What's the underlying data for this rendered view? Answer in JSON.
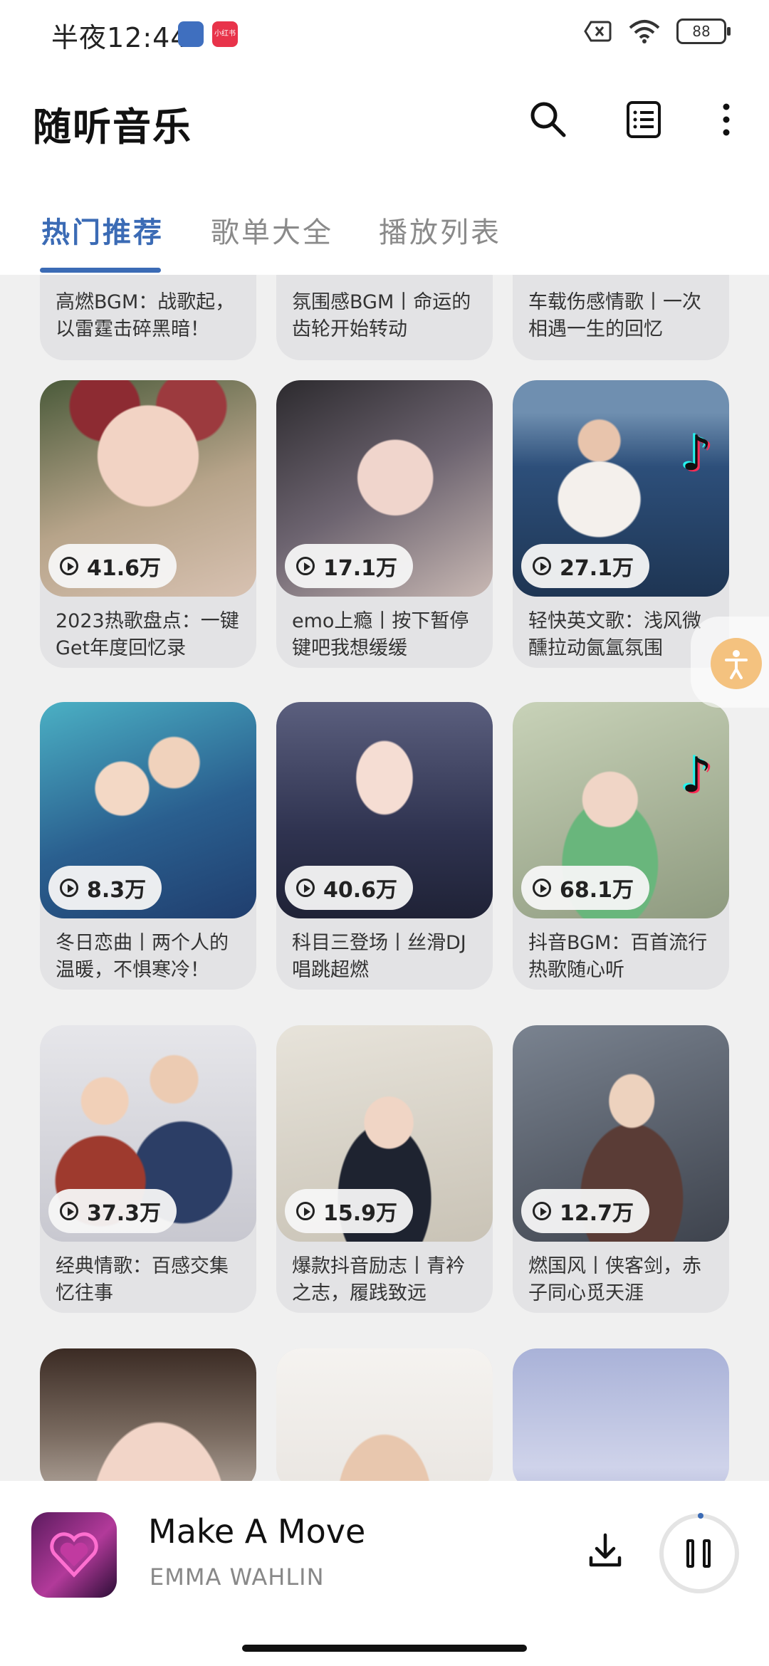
{
  "status_bar": {
    "time": "半夜12:44",
    "notification_app": "小红书",
    "battery": "88"
  },
  "app": {
    "title": "随听音乐"
  },
  "tabs": [
    {
      "label": "热门推荐",
      "active": true
    },
    {
      "label": "歌单大全",
      "active": false
    },
    {
      "label": "播放列表",
      "active": false
    }
  ],
  "top_partial_cards": [
    {
      "title": "高燃BGM：战歌起，以雷霆击碎黑暗！"
    },
    {
      "title": "氛围感BGM丨命运的齿轮开始转动"
    },
    {
      "title": "车载伤感情歌丨一次相遇一生的回忆"
    }
  ],
  "playlists": [
    {
      "plays": "41.6万",
      "title": "2023热歌盘点：一键Get年度回忆录"
    },
    {
      "plays": "17.1万",
      "title": "emo上瘾丨按下暂停键吧我想缓缓"
    },
    {
      "plays": "27.1万",
      "title": "轻快英文歌：浅风微醺拉动氤氲氛围"
    },
    {
      "plays": "8.3万",
      "title": "冬日恋曲丨两个人的温暖，不惧寒冷！"
    },
    {
      "plays": "40.6万",
      "title": "科目三登场丨丝滑DJ唱跳超燃"
    },
    {
      "plays": "68.1万",
      "title": "抖音BGM：百首流行热歌随心听"
    },
    {
      "plays": "37.3万",
      "title": "经典情歌：百感交集忆往事"
    },
    {
      "plays": "15.9万",
      "title": "爆款抖音励志丨青衿之志，履践致远"
    },
    {
      "plays": "12.7万",
      "title": "燃国风丨侠客剑，赤子同心觅天涯"
    }
  ],
  "player": {
    "song_title": "Make A Move",
    "artist": "EMMA WAHLIN"
  }
}
